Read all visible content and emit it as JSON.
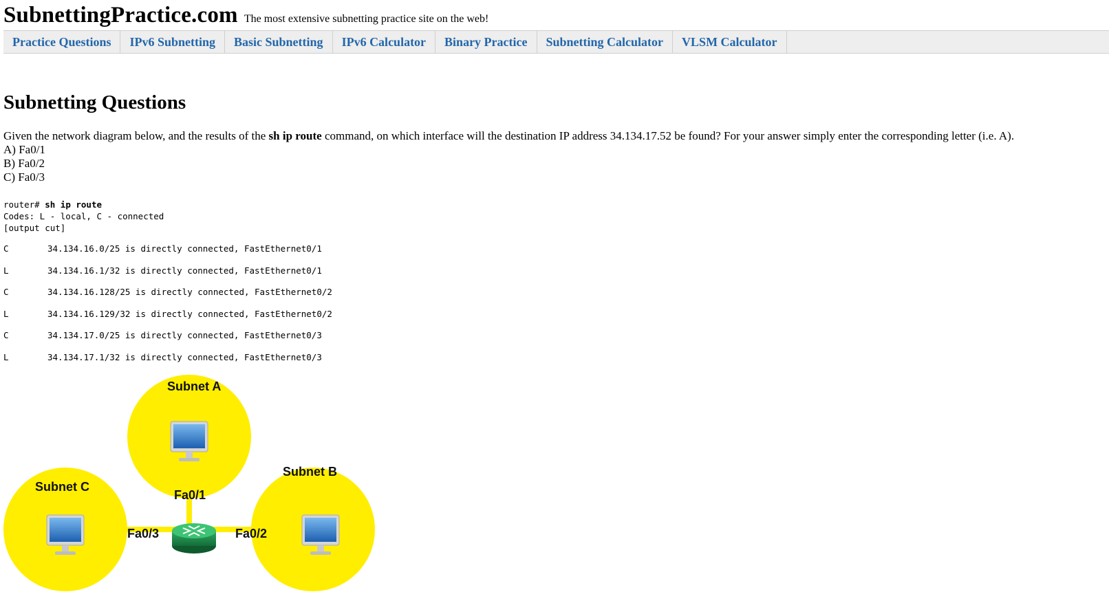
{
  "header": {
    "site_title": "SubnettingPractice.com",
    "tagline": "The most extensive subnetting practice site on the web!"
  },
  "nav": {
    "items": [
      "Practice Questions",
      "IPv6 Subnetting",
      "Basic Subnetting",
      "IPv6 Calculator",
      "Binary Practice",
      "Subnetting Calculator",
      "VLSM Calculator"
    ],
    "link_color": "#2266aa"
  },
  "main": {
    "heading": "Subnetting Questions",
    "question": {
      "prefix": "Given the network diagram below, and the results of the ",
      "command": "sh ip route",
      "suffix": " command, on which interface will the destination IP address 34.134.17.52 be found? For your answer simply enter the corresponding letter (i.e. A).",
      "options": [
        "A) Fa0/1",
        "B) Fa0/2",
        "C) Fa0/3"
      ]
    },
    "cli": {
      "prompt": "router# ",
      "command": "sh ip route",
      "codes_line": "Codes: L - local, C - connected",
      "output_cut": "[output cut]"
    },
    "routes": [
      {
        "code": "C",
        "text": "34.134.16.0/25 is directly connected, FastEthernet0/1"
      },
      {
        "code": "L",
        "text": "34.134.16.1/32 is directly connected, FastEthernet0/1"
      },
      {
        "code": "C",
        "text": "34.134.16.128/25 is directly connected, FastEthernet0/2"
      },
      {
        "code": "L",
        "text": "34.134.16.129/32 is directly connected, FastEthernet0/2"
      },
      {
        "code": "C",
        "text": "34.134.17.0/25 is directly connected, FastEthernet0/3"
      },
      {
        "code": "L",
        "text": "34.134.17.1/32 is directly connected, FastEthernet0/3"
      }
    ]
  },
  "diagram": {
    "subnet_a": "Subnet A",
    "subnet_b": "Subnet B",
    "subnet_c": "Subnet C",
    "iface_1": "Fa0/1",
    "iface_2": "Fa0/2",
    "iface_3": "Fa0/3",
    "subnet_color": "#ffee00",
    "router_color": "#1e8a4c",
    "icons": [
      "computer-icon",
      "router-icon"
    ]
  }
}
